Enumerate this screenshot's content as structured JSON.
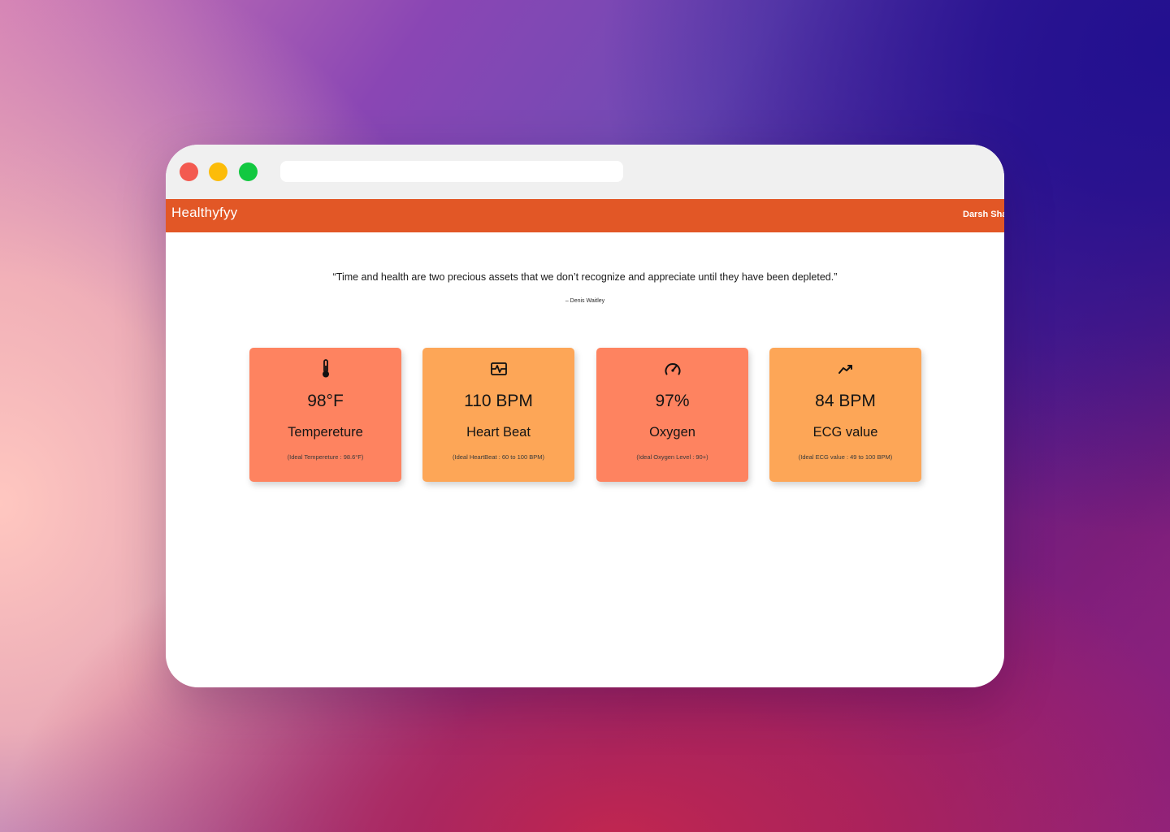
{
  "app": {
    "brand": "Healthyfyy",
    "user_name": "Darsh Sha"
  },
  "colors": {
    "navbar": "#e25726",
    "card_coral": "#fe8360",
    "card_orange": "#fda657",
    "traffic_red": "#f35a50",
    "traffic_yellow": "#fcbc09",
    "traffic_green": "#12c840"
  },
  "quote": {
    "text": "“Time and health are two precious assets that we don’t recognize and appreciate until they have been depleted.”",
    "author": "– Denis Waitley"
  },
  "cards": [
    {
      "icon": "thermometer-icon",
      "value": "98°F",
      "label": "Tempereture",
      "ideal": "(Ideal Tempereture : 98.6°F)",
      "color": "#fe8360"
    },
    {
      "icon": "heartbeat-icon",
      "value": "110 BPM",
      "label": "Heart Beat",
      "ideal": "(Ideal HeartBeat : 60 to 100 BPM)",
      "color": "#fda657"
    },
    {
      "icon": "gauge-icon",
      "value": "97%",
      "label": "Oxygen",
      "ideal": "(Ideal Oxygen Level : 90+)",
      "color": "#fe8360"
    },
    {
      "icon": "trend-icon",
      "value": "84 BPM",
      "label": "ECG value",
      "ideal": "(Ideal ECG value : 49 to 100 BPM)",
      "color": "#fda657"
    }
  ]
}
